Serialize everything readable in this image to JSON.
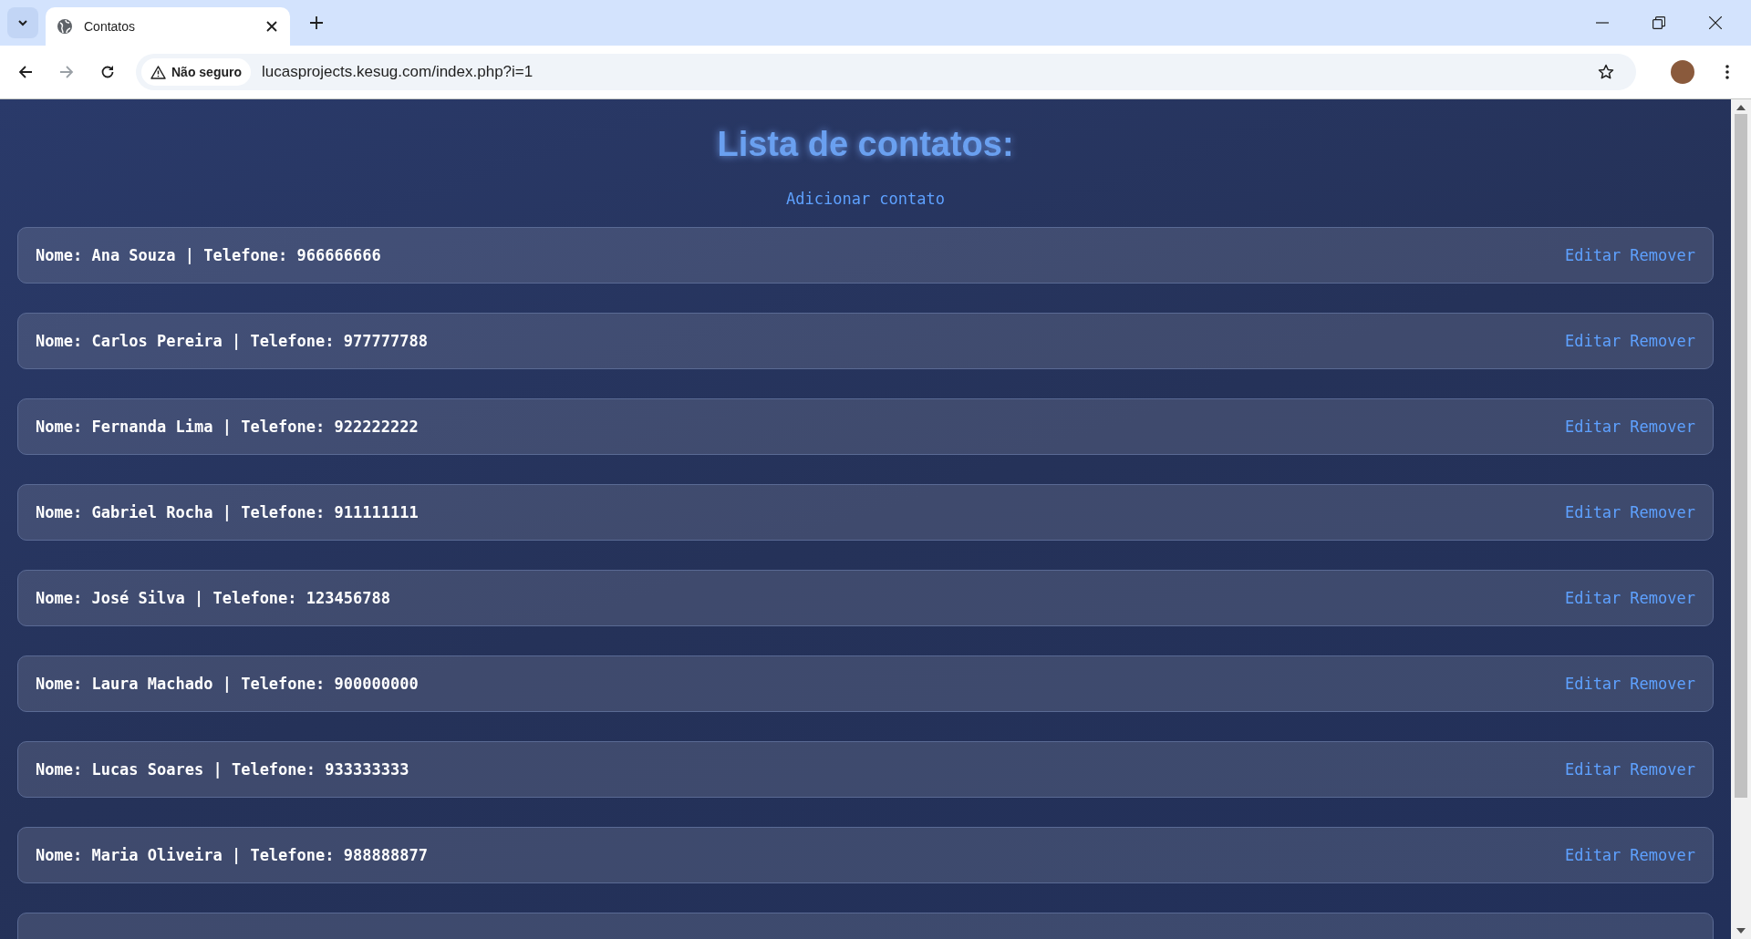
{
  "browser": {
    "tab": {
      "title": "Contatos"
    },
    "security": "Não seguro",
    "url": "lucasprojects.kesug.com/index.php?i=1"
  },
  "page": {
    "title": "Lista de contatos:",
    "add_link": "Adicionar contato",
    "contacts": [
      {
        "text": "Nome: Ana Souza | Telefone: 966666666",
        "actions": [
          "Editar",
          "Remover"
        ]
      },
      {
        "text": "Nome: Carlos Pereira | Telefone: 977777788",
        "actions": [
          "Editar",
          "Remover"
        ]
      },
      {
        "text": "Nome: Fernanda Lima | Telefone: 922222222",
        "actions": [
          "Editar",
          "Remover"
        ]
      },
      {
        "text": "Nome: Gabriel Rocha | Telefone: 911111111",
        "actions": [
          "Editar",
          "Remover"
        ]
      },
      {
        "text": "Nome: José Silva | Telefone: 123456788",
        "actions": [
          "Editar",
          "Remover"
        ]
      },
      {
        "text": "Nome: Laura Machado | Telefone: 900000000",
        "actions": [
          "Editar",
          "Remover"
        ]
      },
      {
        "text": "Nome: Lucas Soares | Telefone: 933333333",
        "actions": [
          "Editar",
          "Remover"
        ]
      },
      {
        "text": "Nome: Maria Oliveira | Telefone: 988888877",
        "actions": [
          "Editar",
          "Remover"
        ]
      }
    ]
  }
}
